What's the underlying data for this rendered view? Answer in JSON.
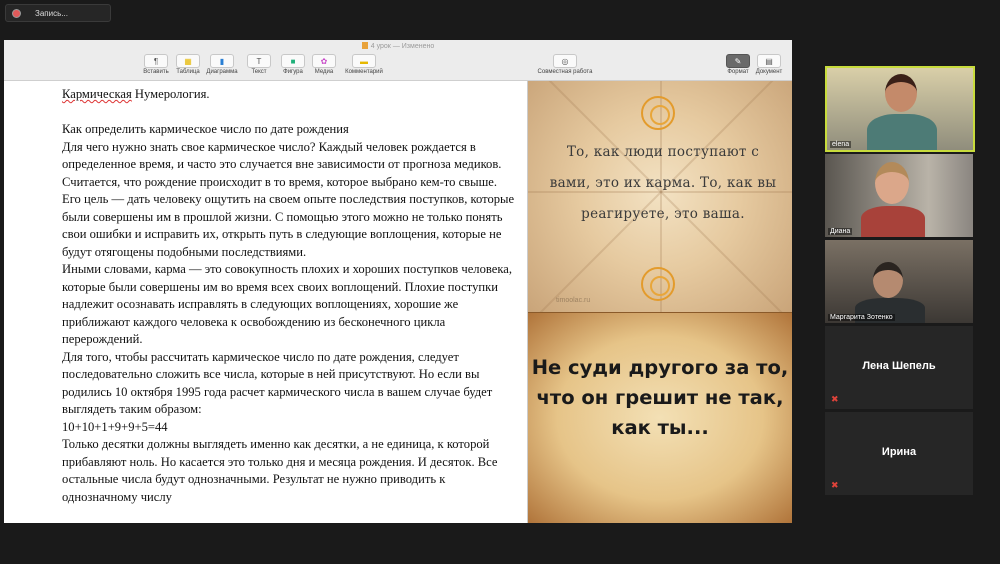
{
  "recording": {
    "label": "Запись..."
  },
  "document": {
    "title": "4 урок — Изменено",
    "toolbar": [
      {
        "label": "Вставить",
        "icon": "¶"
      },
      {
        "label": "Таблица",
        "icon": "▦"
      },
      {
        "label": "Диаграмма",
        "icon": "▮"
      },
      {
        "label": "Текст",
        "icon": "T"
      },
      {
        "label": "Фигура",
        "icon": "■"
      },
      {
        "label": "Медиа",
        "icon": "✿"
      },
      {
        "label": "Комментарий",
        "icon": "▬"
      },
      {
        "label": "Совместная работа",
        "icon": "◎"
      },
      {
        "label": "Формат",
        "icon": "✎"
      },
      {
        "label": "Документ",
        "icon": "▤"
      }
    ],
    "body": {
      "heading_word": "Кармическая",
      "heading_rest": " Нумерология.",
      "p1": "Как определить кармическое число по дате рождения",
      "p2": "Для чего нужно знать свое кармическое число? Каждый человек рождается в определенное время, и часто это случается вне зависимости от прогноза медиков. Считается, что рождение происходит в то время, которое выбрано кем-то свыше. Его цель — дать человеку ощутить на своем опыте последствия поступков, которые были совершены им в прошлой жизни. С помощью этого можно не только понять свои ошибки и исправить их, открыть путь в следующие воплощения, которые не будут отягощены подобными последствиями.",
      "p3": "Иными словами, карма — это совокупность плохих и хороших поступков человека, которые были совершены им во время всех своих воплощений. Плохие поступки надлежит осознавать исправлять в следующих воплощениях, хорошие же приближают каждого человека к освобождению из бесконечного цикла перерождений.",
      "p4": "Для того, чтобы рассчитать кармическое число по дате рождения, следует последовательно сложить все числа, которые в ней присутствуют. Но если  вы родились 10 октября 1995 года расчет кармического числа в вашем случае будет выглядеть таким образом:",
      "p5": "10+10+1+9+9+5=44",
      "p6": "Только десятки должны выглядеть именно как десятки, а не единица, к которой прибавляют ноль. Но касается это только дня и месяца рождения. И десяток. Все остальные числа будут однозначными. Результат не нужно приводить к однозначному числу"
    },
    "image1_quote": "То, как люди поступают с вами, это их карма. То, как вы реагируете, это ваша.",
    "image1_watermark": "timoolac.ru",
    "image2_quote": "Не суди другого за то, что он грешит не так, как ты..."
  },
  "participants": [
    {
      "name": "elena",
      "type": "video",
      "active": true
    },
    {
      "name": "Диана",
      "type": "video",
      "active": false
    },
    {
      "name": "Маргарита Зотенко",
      "type": "video",
      "active": false
    },
    {
      "name": "Лена Шепель",
      "type": "name",
      "muted": true
    },
    {
      "name": "Ирина",
      "type": "name",
      "muted": true
    }
  ],
  "colors": {
    "active_speaker": "#c8dc3c",
    "muted": "#e0433a",
    "spell_underline": "#d33"
  }
}
